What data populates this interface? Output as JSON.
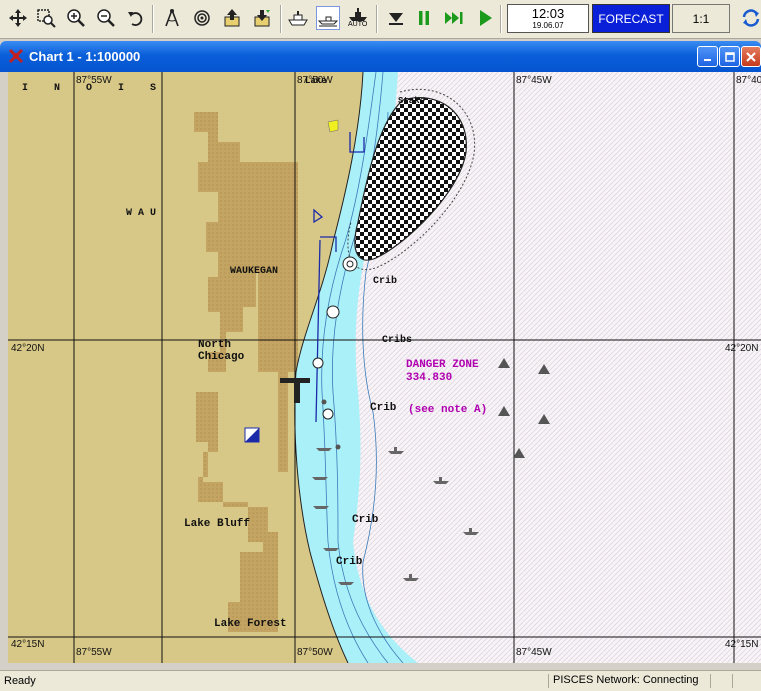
{
  "toolbar": {
    "buttons": [
      {
        "name": "pan-icon"
      },
      {
        "name": "zoom-window-icon"
      },
      {
        "name": "zoom-in-icon"
      },
      {
        "name": "zoom-out-icon"
      },
      {
        "name": "undo-view-icon"
      },
      {
        "name": "compass-icon"
      },
      {
        "name": "target-icon"
      },
      {
        "name": "export-icon"
      },
      {
        "name": "import-icon"
      },
      {
        "name": "ship-icon"
      },
      {
        "name": "route-icon"
      },
      {
        "name": "auto-icon"
      },
      {
        "name": "stop-icon"
      },
      {
        "name": "pause-icon"
      },
      {
        "name": "fast-forward-icon"
      },
      {
        "name": "play-icon"
      }
    ],
    "auto_label": "AUTO",
    "clock_time": "12:03",
    "clock_date": "19.06.07",
    "forecast_label": "FORECAST",
    "scale_label": "1:1"
  },
  "window": {
    "title": "Chart 1 - 1:100000"
  },
  "chart": {
    "top_lon_labels": [
      "87°55W",
      "87°50W",
      "87°45W",
      "87°40"
    ],
    "bottom_lon_labels": [
      "87°55W",
      "87°50W",
      "87°45W"
    ],
    "lat_labels_left": [
      "42°20N",
      "42°15N"
    ],
    "lat_labels_right": [
      "42°20N",
      "42°15N"
    ],
    "state_letters": [
      "I",
      "N",
      "O",
      "I",
      "S"
    ],
    "places": {
      "waukegan": "WAUKEGAN",
      "wau": "W A U",
      "north": "North",
      "chicago": "Chicago",
      "lake_bluff": "Lake Bluff",
      "lake_forest": "Lake Forest",
      "crib_top": "Crib",
      "cribs": "Cribs",
      "crib_mid": "Crib",
      "crib_low": "Crib",
      "crib_bottom": "Crib",
      "lake_top": "Lake",
      "stake": "Stake"
    },
    "danger_zone": {
      "title": "DANGER ZONE",
      "code": "334.830",
      "note": "(see note A)"
    },
    "colors": {
      "land": "#d8c888",
      "urban": "#c0a060",
      "shallow": "#aaf0f8",
      "deep": "#f7f3f7",
      "danger": "#b000b0"
    }
  },
  "status": {
    "ready": "Ready",
    "network": "PISCES Network: Connecting"
  }
}
